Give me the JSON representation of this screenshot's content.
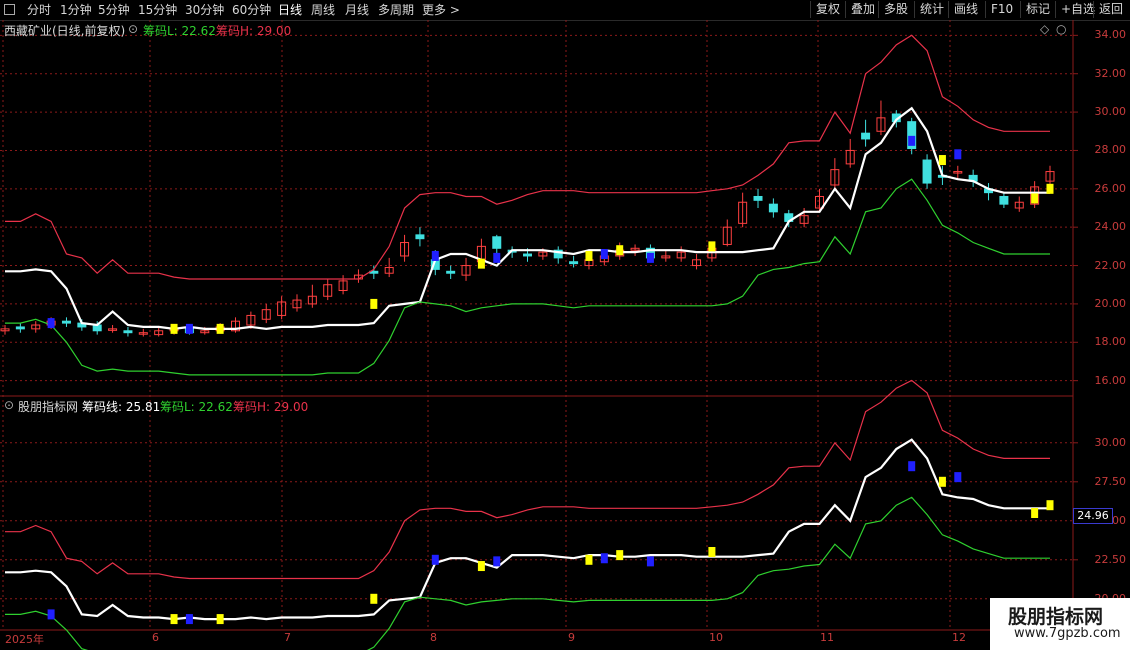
{
  "toolbar": {
    "periods": [
      "分时",
      "1分钟",
      "5分钟",
      "15分钟",
      "30分钟",
      "60分钟",
      "日线",
      "周线",
      "月线",
      "多周期",
      "更多 >"
    ],
    "active_period": "日线",
    "buttons": [
      "复权",
      "叠加",
      "多股",
      "统计",
      "画线",
      "F10",
      "标记",
      "+自选",
      "返回"
    ]
  },
  "main_chart": {
    "title": "西藏矿业(日线,前复权)",
    "legend_l": "筹码L: 22.62",
    "legend_h": "筹码H: 29.00",
    "y_ticks": [
      "34.00",
      "32.00",
      "30.00",
      "28.00",
      "26.00",
      "24.00",
      "22.00",
      "20.00",
      "18.00",
      "16.00"
    ]
  },
  "sub_chart": {
    "title": "股朋指标网",
    "legend_line": "筹码线: 25.81",
    "legend_l": "筹码L: 22.62",
    "legend_h": "筹码H: 29.00",
    "y_ticks": [
      "30.00",
      "27.50",
      "25.00",
      "22.50",
      "20.00"
    ],
    "current_value": "24.96"
  },
  "x_axis": {
    "labels": [
      "2025年",
      "6",
      "7",
      "8",
      "9",
      "10",
      "11",
      "12"
    ]
  },
  "watermark": {
    "title": "股朋指标网",
    "url": "www.7gpzb.com"
  },
  "colors": {
    "white_line": "#ffffff",
    "red_line": "#e8324a",
    "green_line": "#2fd02f",
    "up_candle": "#ff4040",
    "down_candle": "#40e0e0",
    "yellow_mark": "#ffff00",
    "blue_mark": "#2020ff",
    "grid": "#8b1a1a"
  },
  "chart_data": [
    {
      "type": "line",
      "title": "",
      "ylim": [
        15.2,
        34.8
      ],
      "series": [
        {
          "values": [
            21.7,
            21.7,
            21.8,
            21.7,
            20.8,
            19.0,
            18.9,
            19.6,
            18.9,
            18.8,
            18.8,
            18.7,
            18.8,
            18.7,
            18.7,
            18.7,
            18.8,
            18.7,
            18.8,
            18.8,
            18.8,
            18.9,
            18.9,
            18.9,
            19.0,
            19.9,
            20.0,
            20.1,
            22.3,
            22.6,
            22.6,
            22.3,
            22.0,
            22.8,
            22.8,
            22.8,
            22.7,
            22.6,
            22.8,
            22.8,
            22.7,
            22.7,
            22.8,
            22.8,
            22.8,
            22.7,
            22.7,
            22.7,
            22.7,
            22.8,
            22.9,
            24.3,
            24.8,
            24.8,
            26.0,
            25.0,
            27.8,
            28.4,
            29.6,
            30.2,
            29.0,
            26.7,
            26.5,
            26.4,
            26.0,
            25.8,
            25.8,
            25.8,
            25.8
          ]
        },
        {
          "values": [
            24.3,
            24.3,
            24.7,
            24.3,
            22.6,
            22.4,
            21.6,
            22.3,
            21.6,
            21.6,
            21.6,
            21.4,
            21.3,
            21.3,
            21.3,
            21.3,
            21.3,
            21.3,
            21.3,
            21.3,
            21.3,
            21.3,
            21.3,
            21.3,
            21.8,
            23.0,
            25.0,
            25.7,
            25.8,
            25.8,
            25.6,
            25.6,
            25.2,
            25.4,
            25.7,
            25.9,
            25.9,
            25.9,
            25.8,
            25.8,
            25.8,
            25.8,
            25.8,
            25.8,
            25.8,
            25.8,
            25.9,
            26.0,
            26.2,
            26.7,
            27.3,
            28.4,
            28.5,
            28.5,
            30.0,
            28.9,
            32.0,
            32.6,
            33.5,
            34.0,
            33.2,
            30.8,
            30.3,
            29.6,
            29.2,
            29.0,
            29.0,
            29.0,
            29.0
          ]
        },
        {
          "values": [
            19.0,
            19.0,
            19.2,
            18.9,
            18.0,
            16.8,
            16.5,
            16.6,
            16.5,
            16.5,
            16.5,
            16.4,
            16.3,
            16.3,
            16.3,
            16.3,
            16.3,
            16.3,
            16.3,
            16.3,
            16.3,
            16.4,
            16.4,
            16.4,
            16.9,
            18.1,
            19.8,
            20.1,
            20.0,
            19.9,
            19.6,
            19.8,
            19.9,
            20.0,
            20.0,
            20.0,
            19.9,
            19.8,
            19.9,
            19.9,
            19.9,
            19.9,
            19.9,
            19.9,
            19.9,
            19.9,
            19.9,
            20.0,
            20.4,
            21.5,
            21.8,
            21.9,
            22.1,
            22.2,
            23.5,
            22.6,
            24.8,
            25.0,
            26.0,
            26.5,
            25.4,
            24.1,
            23.7,
            23.2,
            22.9,
            22.6,
            22.6,
            22.6,
            22.6
          ]
        }
      ]
    },
    {
      "type": "line",
      "title": "",
      "ylim": [
        18.0,
        33.0
      ],
      "series": [
        {
          "values": [
            21.7,
            21.7,
            21.8,
            21.7,
            20.8,
            19.0,
            18.9,
            19.6,
            18.9,
            18.8,
            18.8,
            18.7,
            18.8,
            18.7,
            18.7,
            18.7,
            18.8,
            18.7,
            18.8,
            18.8,
            18.8,
            18.9,
            18.9,
            18.9,
            19.0,
            19.9,
            20.0,
            20.1,
            22.3,
            22.6,
            22.6,
            22.3,
            22.0,
            22.8,
            22.8,
            22.8,
            22.7,
            22.6,
            22.8,
            22.8,
            22.7,
            22.7,
            22.8,
            22.8,
            22.8,
            22.7,
            22.7,
            22.7,
            22.7,
            22.8,
            22.9,
            24.3,
            24.8,
            24.8,
            26.0,
            25.0,
            27.8,
            28.4,
            29.6,
            30.2,
            29.0,
            26.7,
            26.5,
            26.4,
            26.0,
            25.8,
            25.8,
            25.8,
            25.8
          ]
        },
        {
          "values": [
            24.3,
            24.3,
            24.7,
            24.3,
            22.6,
            22.4,
            21.6,
            22.3,
            21.6,
            21.6,
            21.6,
            21.4,
            21.3,
            21.3,
            21.3,
            21.3,
            21.3,
            21.3,
            21.3,
            21.3,
            21.3,
            21.3,
            21.3,
            21.3,
            21.8,
            23.0,
            25.0,
            25.7,
            25.8,
            25.8,
            25.6,
            25.6,
            25.2,
            25.4,
            25.7,
            25.9,
            25.9,
            25.9,
            25.8,
            25.8,
            25.8,
            25.8,
            25.8,
            25.8,
            25.8,
            25.8,
            25.9,
            26.0,
            26.2,
            26.7,
            27.3,
            28.4,
            28.5,
            28.5,
            30.0,
            28.9,
            32.0,
            32.6,
            33.5,
            34.0,
            33.2,
            30.8,
            30.3,
            29.6,
            29.2,
            29.0,
            29.0,
            29.0,
            29.0
          ]
        },
        {
          "values": [
            19.0,
            19.0,
            19.2,
            18.9,
            18.0,
            16.8,
            16.5,
            16.6,
            16.5,
            16.5,
            16.5,
            16.4,
            16.3,
            16.3,
            16.3,
            16.3,
            16.3,
            16.3,
            16.3,
            16.3,
            16.3,
            16.4,
            16.4,
            16.4,
            16.9,
            18.1,
            19.8,
            20.1,
            20.0,
            19.9,
            19.6,
            19.8,
            19.9,
            20.0,
            20.0,
            20.0,
            19.9,
            19.8,
            19.9,
            19.9,
            19.9,
            19.9,
            19.9,
            19.9,
            19.9,
            19.9,
            19.9,
            20.0,
            20.4,
            21.5,
            21.8,
            21.9,
            22.1,
            22.2,
            23.5,
            22.6,
            24.8,
            25.0,
            26.0,
            26.5,
            25.4,
            24.1,
            23.7,
            23.2,
            22.9,
            22.6,
            22.6,
            22.6,
            22.6
          ]
        }
      ]
    }
  ],
  "candles": {
    "open": [
      18.6,
      18.8,
      18.7,
      18.9,
      19.1,
      19.0,
      18.9,
      18.7,
      18.6,
      18.5,
      18.4,
      18.6,
      18.7,
      18.5,
      18.6,
      18.6,
      18.9,
      19.2,
      19.4,
      19.8,
      20.0,
      20.4,
      20.7,
      21.3,
      21.7,
      21.6,
      22.5,
      23.6,
      22.3,
      21.7,
      21.5,
      22.2,
      23.5,
      22.8,
      22.6,
      22.5,
      22.8,
      22.2,
      22.0,
      22.2,
      22.5,
      22.8,
      22.9,
      22.4,
      22.4,
      22.0,
      22.4,
      23.1,
      24.2,
      25.6,
      25.2,
      24.7,
      24.2,
      25.0,
      26.2,
      27.3,
      28.9,
      29.0,
      29.9,
      29.5,
      27.5,
      26.7,
      26.9,
      26.7,
      26.0,
      25.6,
      25.0,
      25.2,
      26.4
    ],
    "close": [
      18.7,
      18.7,
      18.9,
      19.1,
      19.0,
      18.8,
      18.6,
      18.7,
      18.5,
      18.5,
      18.6,
      18.7,
      18.5,
      18.6,
      18.8,
      19.1,
      19.4,
      19.7,
      20.1,
      20.2,
      20.4,
      21.0,
      21.2,
      21.5,
      21.6,
      21.9,
      23.2,
      23.4,
      21.8,
      21.6,
      22.0,
      23.0,
      22.9,
      22.7,
      22.5,
      22.7,
      22.4,
      22.1,
      22.3,
      22.5,
      22.8,
      22.9,
      22.4,
      22.5,
      22.7,
      22.3,
      22.9,
      24.0,
      25.3,
      25.4,
      24.8,
      24.3,
      24.6,
      25.6,
      27.0,
      28.0,
      28.6,
      29.7,
      29.5,
      28.1,
      26.3,
      26.6,
      26.9,
      26.4,
      25.8,
      25.2,
      25.3,
      26.1,
      26.9
    ],
    "high": [
      18.9,
      19.0,
      19.1,
      19.3,
      19.3,
      19.2,
      19.1,
      18.9,
      18.8,
      18.7,
      18.8,
      18.9,
      18.9,
      18.8,
      19.0,
      19.3,
      19.6,
      20.0,
      20.4,
      20.5,
      21.0,
      21.3,
      21.5,
      21.8,
      22.0,
      22.4,
      23.6,
      24.0,
      22.8,
      22.0,
      22.4,
      23.4,
      23.6,
      23.0,
      22.9,
      22.9,
      23.0,
      22.5,
      22.6,
      22.8,
      23.2,
      23.1,
      23.1,
      22.8,
      23.0,
      22.6,
      23.2,
      24.4,
      25.8,
      26.0,
      25.5,
      24.9,
      25.0,
      26.0,
      27.6,
      28.6,
      29.6,
      30.6,
      30.1,
      29.7,
      27.8,
      27.2,
      27.2,
      27.0,
      26.3,
      25.8,
      25.6,
      26.4,
      27.2
    ],
    "low": [
      18.4,
      18.5,
      18.5,
      18.7,
      18.8,
      18.6,
      18.4,
      18.5,
      18.3,
      18.3,
      18.3,
      18.4,
      18.4,
      18.4,
      18.5,
      18.5,
      18.7,
      19.0,
      19.2,
      19.6,
      19.8,
      20.2,
      20.5,
      21.1,
      21.3,
      21.4,
      22.2,
      23.0,
      21.5,
      21.3,
      21.2,
      22.0,
      22.6,
      22.4,
      22.2,
      22.3,
      22.1,
      21.9,
      21.8,
      22.0,
      22.3,
      22.5,
      22.2,
      22.2,
      22.2,
      21.8,
      22.2,
      23.0,
      24.0,
      25.0,
      24.5,
      24.0,
      24.0,
      24.8,
      26.0,
      27.1,
      28.2,
      28.8,
      29.2,
      27.8,
      26.0,
      26.2,
      26.5,
      26.1,
      25.4,
      25.0,
      24.8,
      25.0,
      26.2
    ]
  },
  "marks": [
    {
      "i": 3,
      "v": 19.0,
      "c": "blue"
    },
    {
      "i": 11,
      "v": 18.7,
      "c": "yellow"
    },
    {
      "i": 12,
      "v": 18.7,
      "c": "blue"
    },
    {
      "i": 14,
      "v": 18.7,
      "c": "yellow"
    },
    {
      "i": 24,
      "v": 20.0,
      "c": "yellow"
    },
    {
      "i": 28,
      "v": 22.5,
      "c": "blue"
    },
    {
      "i": 31,
      "v": 22.1,
      "c": "yellow"
    },
    {
      "i": 32,
      "v": 22.4,
      "c": "blue"
    },
    {
      "i": 38,
      "v": 22.5,
      "c": "yellow"
    },
    {
      "i": 39,
      "v": 22.6,
      "c": "blue"
    },
    {
      "i": 40,
      "v": 22.8,
      "c": "yellow"
    },
    {
      "i": 42,
      "v": 22.4,
      "c": "blue"
    },
    {
      "i": 46,
      "v": 23.0,
      "c": "yellow"
    },
    {
      "i": 59,
      "v": 28.5,
      "c": "blue"
    },
    {
      "i": 61,
      "v": 27.5,
      "c": "yellow"
    },
    {
      "i": 62,
      "v": 27.8,
      "c": "blue"
    },
    {
      "i": 67,
      "v": 25.5,
      "c": "yellow"
    },
    {
      "i": 68,
      "v": 26.0,
      "c": "yellow"
    }
  ]
}
